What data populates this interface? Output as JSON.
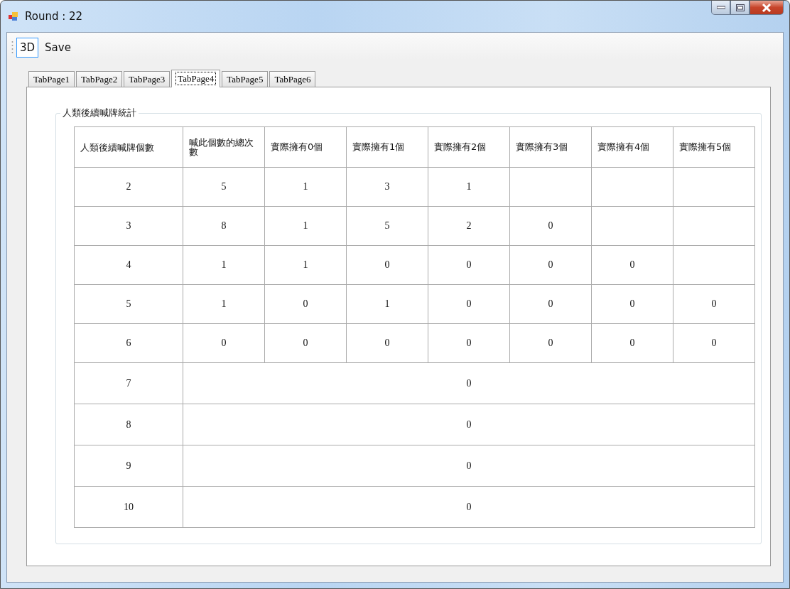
{
  "window": {
    "title": "Round : 22"
  },
  "toolbar": [
    {
      "label": "3D",
      "selected": true
    },
    {
      "label": "Save",
      "selected": false
    }
  ],
  "tabs": [
    {
      "label": "TabPage1",
      "selected": false
    },
    {
      "label": "TabPage2",
      "selected": false
    },
    {
      "label": "TabPage3",
      "selected": false
    },
    {
      "label": "TabPage4",
      "selected": true
    },
    {
      "label": "TabPage5",
      "selected": false
    },
    {
      "label": "TabPage6",
      "selected": false
    }
  ],
  "group": {
    "title": "人類後續喊牌統計"
  },
  "table": {
    "columns": [
      "人類後續喊牌個數",
      "喊此個數的總次數",
      "實際擁有0個",
      "實際擁有1個",
      "實際擁有2個",
      "實際擁有3個",
      "實際擁有4個",
      "實際擁有5個"
    ],
    "rows": [
      {
        "kind": "detail",
        "cells": [
          "2",
          "5",
          "1",
          "3",
          "1"
        ]
      },
      {
        "kind": "detail",
        "cells": [
          "3",
          "8",
          "1",
          "5",
          "2",
          "0"
        ]
      },
      {
        "kind": "detail",
        "cells": [
          "4",
          "1",
          "1",
          "0",
          "0",
          "0",
          "0"
        ]
      },
      {
        "kind": "detail",
        "cells": [
          "5",
          "1",
          "0",
          "1",
          "0",
          "0",
          "0",
          "0"
        ]
      },
      {
        "kind": "detail",
        "cells": [
          "6",
          "0",
          "0",
          "0",
          "0",
          "0",
          "0",
          "0"
        ]
      },
      {
        "kind": "merged",
        "cells": [
          "7",
          {
            "text": "0",
            "colspan": 7
          }
        ]
      },
      {
        "kind": "merged",
        "cells": [
          "8",
          {
            "text": "0",
            "colspan": 7
          }
        ]
      },
      {
        "kind": "merged",
        "cells": [
          "9",
          {
            "text": "0",
            "colspan": 7
          }
        ]
      },
      {
        "kind": "merged",
        "cells": [
          "10",
          {
            "text": "0",
            "colspan": 7
          }
        ]
      }
    ]
  }
}
